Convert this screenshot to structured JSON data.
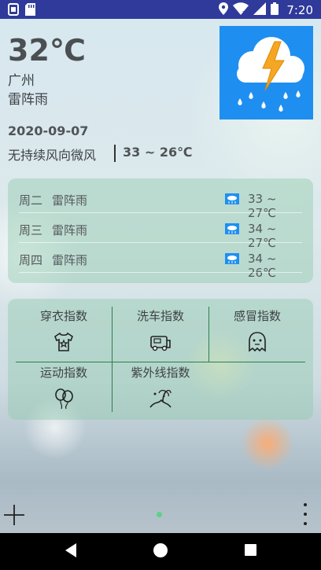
{
  "status_bar": {
    "time": "7:20",
    "left_icons": [
      "notification-icon",
      "sd-card-icon"
    ],
    "right_icons": [
      "location-icon",
      "wifi-icon",
      "signal-icon",
      "battery-icon"
    ]
  },
  "current": {
    "temperature": "32℃",
    "city": "广州",
    "condition": "雷阵雨",
    "date": "2020-09-07",
    "wind": "无持续风向微风",
    "range": "33 ~ 26℃",
    "icon": "thunderstorm-icon"
  },
  "forecast": [
    {
      "day": "周二",
      "condition": "雷阵雨",
      "range": "33 ~ 27℃",
      "icon": "rain-icon"
    },
    {
      "day": "周三",
      "condition": "雷阵雨",
      "range": "34 ~ 27℃",
      "icon": "rain-icon"
    },
    {
      "day": "周四",
      "condition": "雷阵雨",
      "range": "34 ~ 26℃",
      "icon": "rain-icon"
    }
  ],
  "indices": [
    {
      "label": "穿衣指数",
      "icon": "shirt-icon"
    },
    {
      "label": "洗车指数",
      "icon": "car-icon"
    },
    {
      "label": "感冒指数",
      "icon": "ghost-icon"
    },
    {
      "label": "运动指数",
      "icon": "balloons-icon"
    },
    {
      "label": "紫外线指数",
      "icon": "palm-beach-icon"
    }
  ],
  "colors": {
    "status_bar": "#2f3a9a",
    "weather_icon_bg": "#1e8ff0",
    "panel": "#8cc8aa",
    "divider": "#2e7d4f",
    "page_dot": "#5bd28a"
  }
}
